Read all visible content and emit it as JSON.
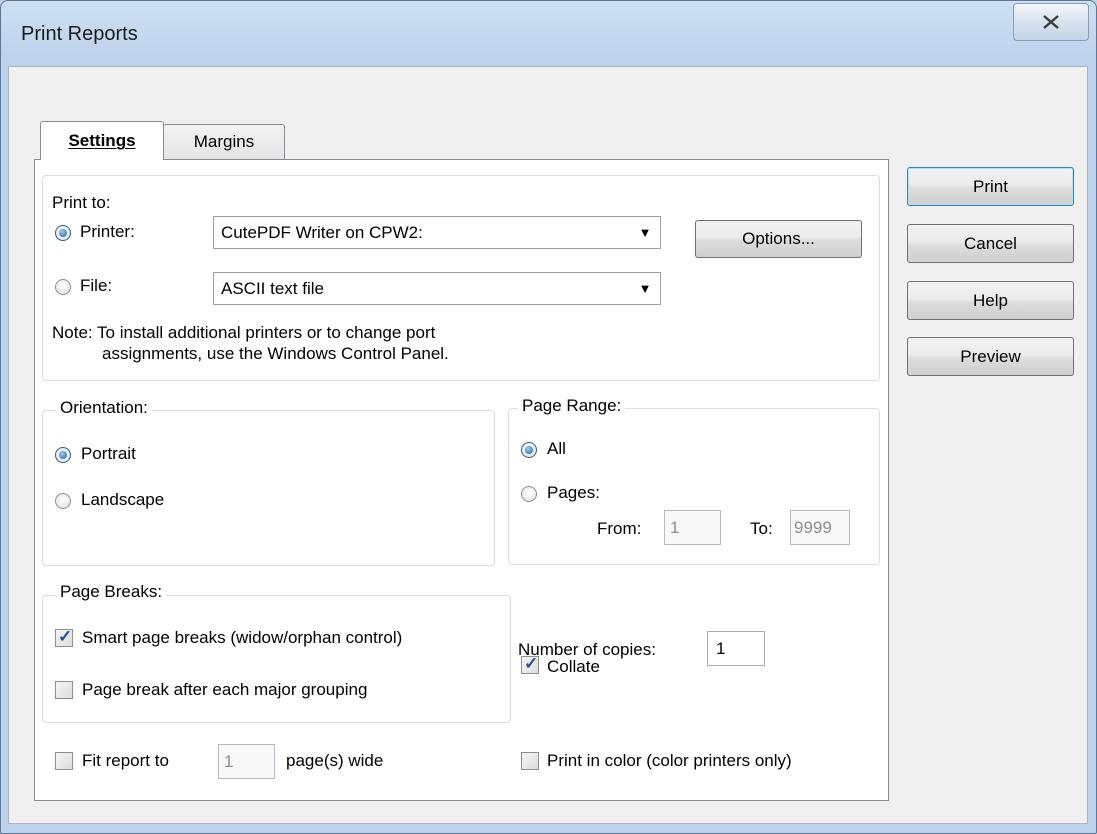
{
  "window": {
    "title": "Print Reports"
  },
  "tabs": [
    {
      "label": "Settings",
      "active": true
    },
    {
      "label": "Margins",
      "active": false
    }
  ],
  "print_to": {
    "heading": "Print to:",
    "printer_label": "Printer:",
    "printer_value": "CutePDF Writer on CPW2:",
    "printer_selected": true,
    "file_label": "File:",
    "file_value": "ASCII text file",
    "options_button": "Options...",
    "note_line1": "Note: To install additional printers or to change port",
    "note_line2": "assignments, use the Windows Control Panel."
  },
  "orientation": {
    "legend": "Orientation:",
    "portrait_label": "Portrait",
    "landscape_label": "Landscape",
    "selected": "Portrait"
  },
  "page_range": {
    "legend": "Page Range:",
    "all_label": "All",
    "pages_label": "Pages:",
    "from_label": "From:",
    "from_value": "1",
    "to_label": "To:",
    "to_value": "9999",
    "selected": "All"
  },
  "page_breaks": {
    "legend": "Page Breaks:",
    "smart_label": "Smart page breaks (widow/orphan control)",
    "smart_checked": true,
    "grouping_label": "Page break after each major grouping",
    "grouping_checked": false
  },
  "copies": {
    "label": "Number of copies:",
    "value": "1",
    "collate_label": "Collate",
    "collate_checked": true
  },
  "fit": {
    "label_before": "Fit report to",
    "value": "1",
    "label_after": "page(s) wide",
    "checked": false
  },
  "color": {
    "label": "Print in color (color printers only)",
    "checked": false
  },
  "buttons": {
    "print": "Print",
    "cancel": "Cancel",
    "help": "Help",
    "preview": "Preview"
  },
  "colors": {
    "frame": "#bdd3ea",
    "client": "#f0f0f0",
    "default_button_border": "#3c7fb1",
    "check_mark": "#2a4f96"
  },
  "icons": {
    "close": "close-x-icon",
    "dropdown": "triangle-down-icon",
    "check": "check-mark-icon"
  }
}
